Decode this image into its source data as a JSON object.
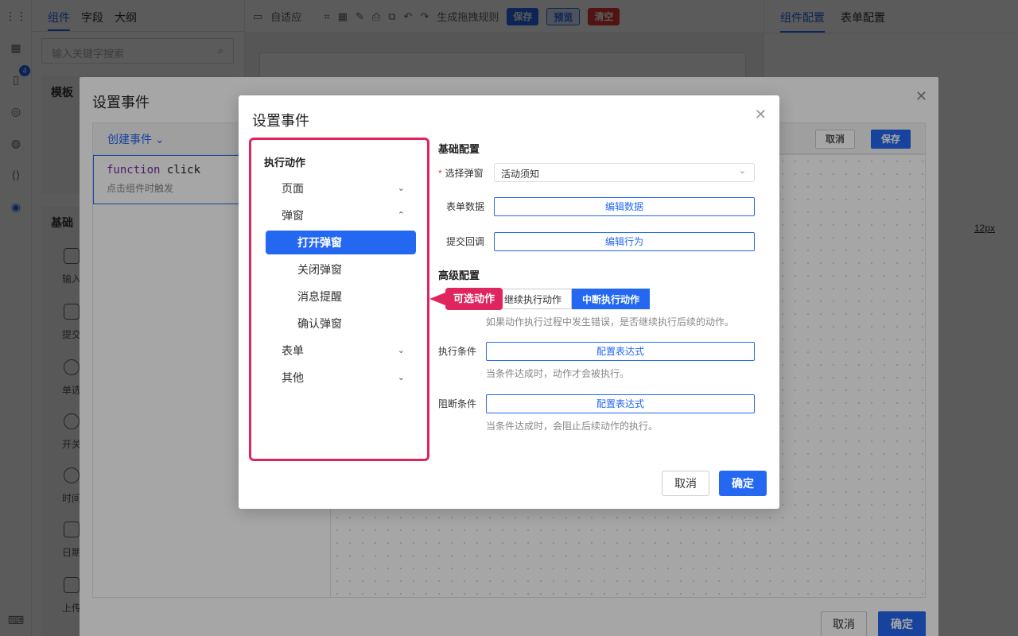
{
  "left_tabs": [
    "组件",
    "字段",
    "大纲"
  ],
  "search_placeholder": "输入关键字搜索",
  "sidebar_badge": "4",
  "left_sections": {
    "templates": "模板",
    "basic": "基础"
  },
  "components": [
    "输入",
    "提交",
    "单选",
    "开关",
    "时间",
    "日期",
    "上传"
  ],
  "toolbar": {
    "adaptive": "自适应",
    "gen_rule": "生成拖拽规则",
    "save": "保存",
    "preview": "预览",
    "clear": "清空"
  },
  "right_tabs": [
    "组件配置",
    "表单配置"
  ],
  "right_extra": {
    "size_text": "12px"
  },
  "dialog1": {
    "title": "设置事件",
    "create_event": "创建事件",
    "event_keyword": "function",
    "event_name": "click",
    "event_desc": "点击组件时触发",
    "cancel": "取消",
    "save": "保存",
    "footer_cancel": "取消",
    "footer_ok": "确定"
  },
  "dialog2": {
    "title": "设置事件",
    "tree_title": "执行动作",
    "tree": {
      "page": "页面",
      "popup": "弹窗",
      "open_popup": "打开弹窗",
      "close_popup": "关闭弹窗",
      "message": "消息提醒",
      "confirm": "确认弹窗",
      "form": "表单",
      "other": "其他"
    },
    "callout": "可选动作",
    "basic_config": "基础配置",
    "select_popup_label": "选择弹窗",
    "select_popup_value": "活动须知",
    "form_data_label": "表单数据",
    "form_data_btn": "编辑数据",
    "submit_cb_label": "提交回调",
    "submit_cb_btn": "编辑行为",
    "advanced_config": "高级配置",
    "seg_continue": "继续执行动作",
    "seg_break": "中断执行动作",
    "seg_hint": "如果动作执行过程中发生错误，是否继续执行后续的动作。",
    "exec_cond_label": "执行条件",
    "exec_cond_btn": "配置表达式",
    "exec_cond_hint": "当条件达成时，动作才会被执行。",
    "block_cond_label": "阻断条件",
    "block_cond_btn": "配置表达式",
    "block_cond_hint": "当条件达成时，会阻止后续动作的执行。",
    "cancel": "取消",
    "ok": "确定"
  },
  "colors": {
    "primary": "#2468f2",
    "highlight": "#e0245e",
    "danger": "#e53935"
  }
}
